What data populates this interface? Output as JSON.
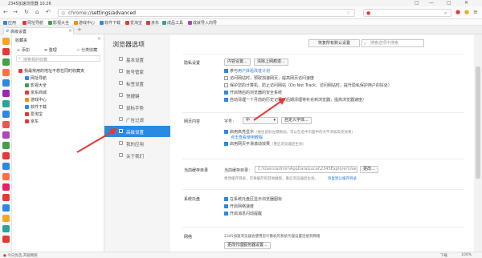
{
  "window": {
    "title": "2345加速浏览器 10.26",
    "controls": [
      "▢",
      "—",
      "▢",
      "✕"
    ]
  },
  "nav": {
    "url_prefix": "chrome://",
    "url_path": "settings/advanced",
    "search_placeholder": ""
  },
  "bookmarks_bar": [
    {
      "label": "应用"
    },
    {
      "label": "网址导航"
    },
    {
      "label": "影视大全"
    },
    {
      "label": "游戏中心"
    },
    {
      "label": "软件下载"
    },
    {
      "label": "爱淘宝"
    },
    {
      "label": "京东"
    },
    {
      "label": "成品工具"
    },
    {
      "label": "成就导入向导"
    }
  ],
  "tab": {
    "label": "高级设置"
  },
  "fav_panel": {
    "title": "收藏夹",
    "actions": [
      "添加",
      "整理",
      "分类收藏"
    ],
    "search_placeholder": "搜索我的收藏",
    "items": [
      {
        "label": "我最常用的地址不想在同时收藏夹",
        "sub": false
      },
      {
        "label": "网址导航",
        "sub": true
      },
      {
        "label": "影视大全",
        "sub": true
      },
      {
        "label": "京东商城",
        "sub": true
      },
      {
        "label": "游戏中心",
        "sub": true
      },
      {
        "label": "软件下载",
        "sub": true
      },
      {
        "label": "爱淘宝",
        "sub": true
      },
      {
        "label": "京东",
        "sub": true
      }
    ],
    "item_colors": [
      "#e53935",
      "#2a8ae3",
      "#43a047",
      "#e53935",
      "#fb8c00",
      "#2a8ae3",
      "#e53935",
      "#e53935"
    ]
  },
  "left_strip_colors": [
    "#f5a623",
    "#e53935",
    "#43a047",
    "#ff7043",
    "#2a8ae3",
    "#9c27b0",
    "#26a69a",
    "#2a8ae3",
    "#ef5350",
    "#ab47bc",
    "#43a047",
    "#e53935",
    "#2a8ae3",
    "#ff7043",
    "#e91e63",
    "#e53935",
    "#2a8ae3",
    "#f5a623",
    "#26a69a",
    "#e53935"
  ],
  "settings_nav": {
    "title": "浏览器选项",
    "items": [
      {
        "label": "基本设置",
        "active": false
      },
      {
        "label": "账号管家",
        "active": false
      },
      {
        "label": "标签设置",
        "active": false
      },
      {
        "label": "快捷键",
        "active": false
      },
      {
        "label": "鼠标手势",
        "active": false
      },
      {
        "label": "广告过滤",
        "active": false
      },
      {
        "label": "高级设置",
        "active": true
      },
      {
        "label": "我的应用",
        "active": false
      },
      {
        "label": "关于我们",
        "active": false
      }
    ]
  },
  "main": {
    "restore_button": "恢复所有默认设置",
    "search_placeholder": "搜索选项中搜索",
    "privacy": {
      "label": "隐私设置",
      "buttons": [
        "内容设置...",
        "清除上网痕迹..."
      ],
      "checks": [
        {
          "text": "参与",
          "link": "用户体验改进计划",
          "checked": true
        },
        {
          "text": "访问网站时，预取加速网页，提高网页访问速度",
          "link": "",
          "checked": false
        },
        {
          "text": "保护您的计算机，防止访问网站（Do Not Track，访问网站时，提升隐私保护用户的好处）",
          "link": "",
          "checked": false
        },
        {
          "text": "开启随后的浏览器的安全系统",
          "link": "",
          "checked": true
        },
        {
          "text": "自动清理一个月前的历史记录（后期清理将补充到浏览器，提高浏览器速度）",
          "link": "",
          "checked": true
        }
      ]
    },
    "web_content": {
      "label": "网页内容",
      "font_label": "字号：",
      "font_value": "中",
      "custom_font_btn": "自定义字体...",
      "checks": [
        {
          "text": "启用高亮显示",
          "note": "（按住鼠标左键拖动，可以在选中页面中的文字添加高亮效果）",
          "link": "点击查看使用教程",
          "checked": true
        },
        {
          "text": "启用网页平滑滚动效果",
          "note": "（重启浏览器后生效）",
          "link": "",
          "checked": true
        }
      ]
    },
    "download": {
      "label": "当前缓存目录",
      "path_label": "当前缓存目录：",
      "path_value": "C:\\Users\\admin\\AppData\\Local\\2345Explorer\\User Dat",
      "change_btn": "更改...",
      "note": "更改缓存目录，可将缓存到其他磁盘，重启浏览器后生效。",
      "link": "恢复默认缓存目录"
    },
    "tray": {
      "label": "系统托盘",
      "checks": [
        {
          "text": "在系统托盘区显示浏览器图标",
          "checked": true
        },
        {
          "text": "开启网络速度",
          "checked": true
        },
        {
          "text": "开启消息闪动提醒",
          "checked": true
        }
      ]
    },
    "network": {
      "label": "网络",
      "note": "2345加速浏览器会使用您计算机的系统代理设置连接到网络",
      "btn": "更改代理服务器设置..."
    }
  },
  "status": {
    "left": "今日优选  开服网络",
    "right": [
      "下载",
      "100%"
    ]
  }
}
